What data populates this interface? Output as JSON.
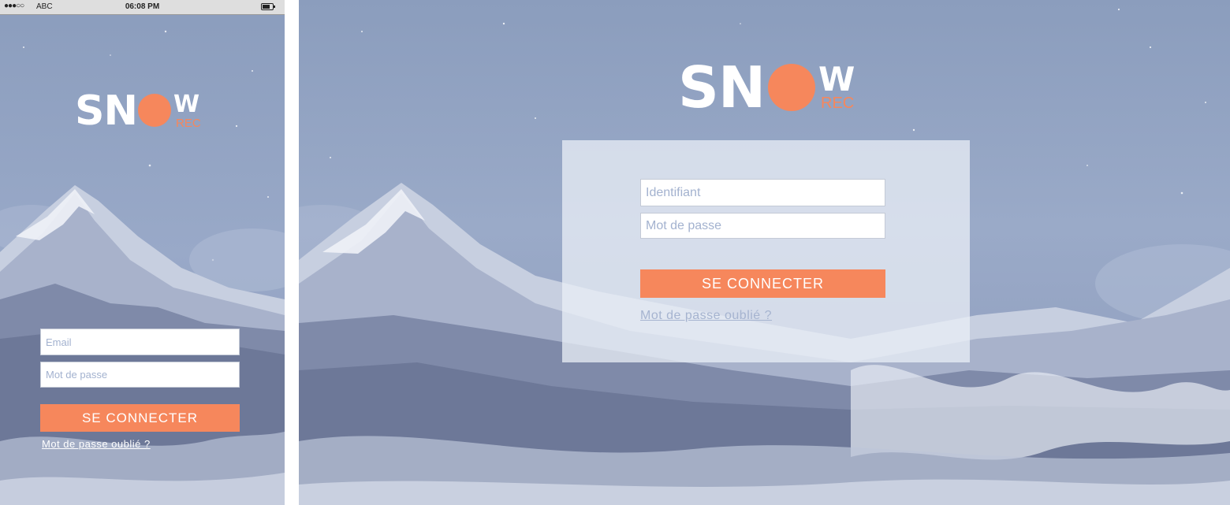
{
  "status_bar": {
    "signal": "●●●○○",
    "carrier": "ABC",
    "time": "06:08 PM",
    "battery_icon": "battery-icon"
  },
  "logo": {
    "text_sn": "SN",
    "text_w": "W",
    "text_rec": "REC",
    "accent_color": "#f6875c"
  },
  "mobile": {
    "email_placeholder": "Email",
    "password_placeholder": "Mot de passe",
    "login_button": "SE CONNECTER",
    "forgot_link": "Mot de passe oublié ?"
  },
  "desktop": {
    "username_placeholder": "Identifiant",
    "password_placeholder": "Mot de passe",
    "login_button": "SE CONNECTER",
    "forgot_link": "Mot de passe oublié ?"
  },
  "colors": {
    "sky": "#8d9fc0",
    "mountain_shadow": "#6b7697",
    "snow": "#eef1f7",
    "button": "#f6875c"
  }
}
